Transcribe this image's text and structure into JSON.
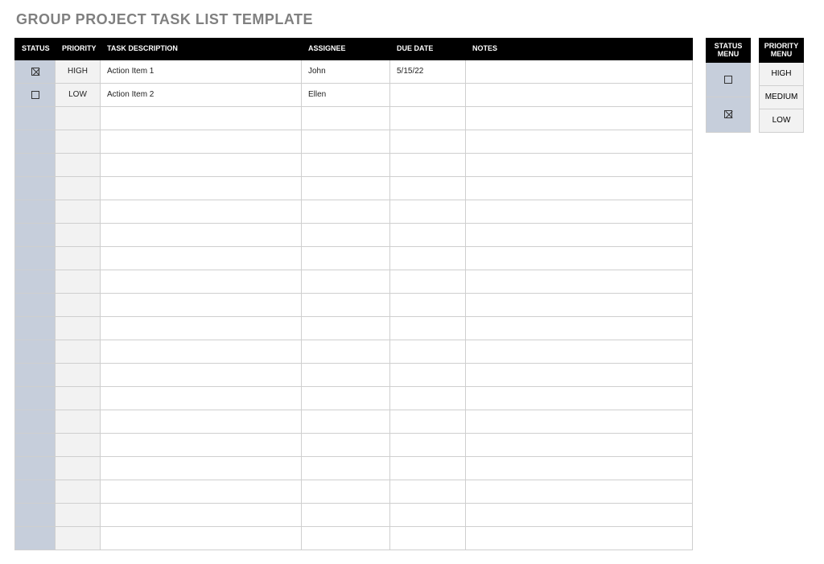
{
  "title": "GROUP PROJECT TASK LIST TEMPLATE",
  "columns": {
    "status": "STATUS",
    "priority": "PRIORITY",
    "task": "TASK DESCRIPTION",
    "assignee": "ASSIGNEE",
    "due": "DUE DATE",
    "notes": "NOTES"
  },
  "rows": [
    {
      "status_checked": true,
      "priority": "HIGH",
      "task": "Action Item 1",
      "assignee": "John",
      "due": "5/15/22",
      "notes": ""
    },
    {
      "status_checked": false,
      "priority": "LOW",
      "task": "Action Item 2",
      "assignee": "Ellen",
      "due": "",
      "notes": ""
    }
  ],
  "empty_row_count": 19,
  "status_menu": {
    "header_line1": "STATUS",
    "header_line2": "MENU",
    "options": [
      {
        "checked": false
      },
      {
        "checked": true
      }
    ]
  },
  "priority_menu": {
    "header_line1": "PRIORITY",
    "header_line2": "MENU",
    "options": [
      "HIGH",
      "MEDIUM",
      "LOW"
    ]
  }
}
